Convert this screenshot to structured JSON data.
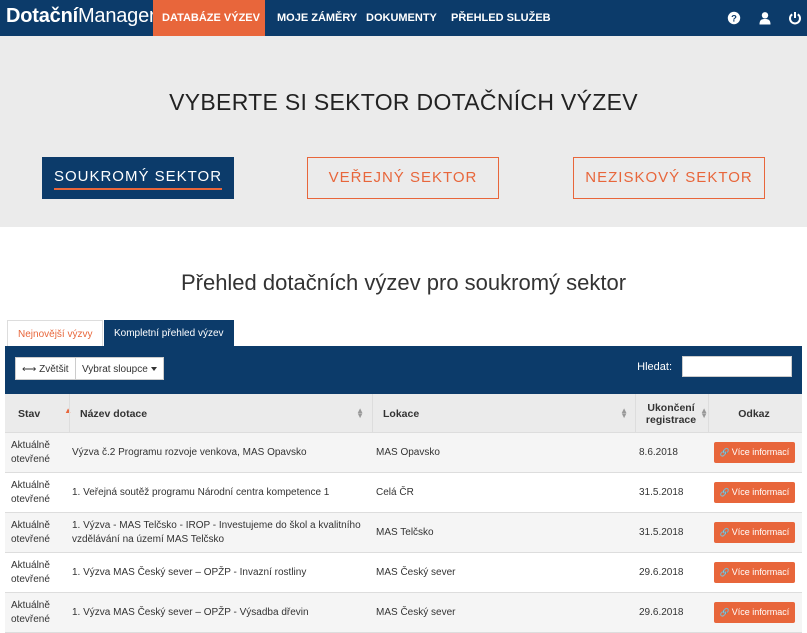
{
  "app": {
    "logo_bold": "Dotační",
    "logo_rest": "Manager"
  },
  "nav": {
    "items": [
      {
        "label": "DATABÁZE VÝZEV"
      },
      {
        "label": "MOJE ZÁMĚRY"
      },
      {
        "label": "DOKUMENTY"
      },
      {
        "label": "PŘEHLED SLUŽEB"
      }
    ],
    "icons": [
      "help-icon",
      "user-icon",
      "power-icon"
    ]
  },
  "hero": {
    "title": "VYBERTE SI SEKTOR DOTAČNÍCH VÝZEV",
    "sectors": [
      {
        "label": "SOUKROMÝ SEKTOR"
      },
      {
        "label": "VEŘEJNÝ SEKTOR"
      },
      {
        "label": "NEZISKOVÝ SEKTOR"
      }
    ]
  },
  "overview": {
    "title": "Přehled dotačních výzev pro soukromý sektor",
    "tabs": [
      {
        "label": "Nejnovější výzvy"
      },
      {
        "label": "Kompletní přehled výzev"
      }
    ],
    "toolbar": {
      "expand_label": "Zvětšit",
      "columns_label": "Vybrat sloupce",
      "search_label": "Hledat:",
      "search_value": ""
    },
    "columns": [
      "Stav",
      "Název dotace",
      "Lokace",
      "Ukončení registrace",
      "Odkaz"
    ],
    "rows": [
      {
        "status": "Aktuálně otevřené",
        "name": "Výzva č.2 Programu rozvoje venkova, MAS Opavsko",
        "location": "MAS Opavsko",
        "date": "8.6.2018",
        "link": "Více informací"
      },
      {
        "status": "Aktuálně otevřené",
        "name": "1. Veřejná soutěž programu Národní centra kompetence 1",
        "location": "Celá ČR",
        "date": "31.5.2018",
        "link": "Více informací"
      },
      {
        "status": "Aktuálně otevřené",
        "name": "1. Výzva - MAS Telčsko - IROP - Investujeme do škol a kvalitního vzdělávání na území MAS Telčsko",
        "location": "MAS Telčsko",
        "date": "31.5.2018",
        "link": "Více informací"
      },
      {
        "status": "Aktuálně otevřené",
        "name": "1. Výzva MAS Český sever – OPŽP - Invazní rostliny",
        "location": "MAS Český sever",
        "date": "29.6.2018",
        "link": "Více informací"
      },
      {
        "status": "Aktuálně otevřené",
        "name": "1. Výzva MAS Český sever – OPŽP - Výsadba dřevin",
        "location": "MAS Český sever",
        "date": "29.6.2018",
        "link": "Více informací"
      }
    ]
  },
  "colors": {
    "navy": "#0c3b6a",
    "accent": "#e8663b"
  }
}
